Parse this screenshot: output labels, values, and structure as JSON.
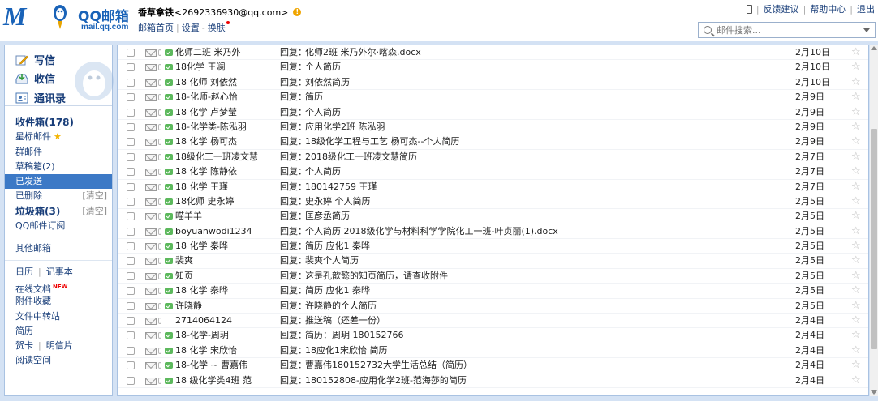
{
  "header": {
    "logo_domain": "mail.qq.com",
    "user_name": "香草拿铁",
    "user_email": "<2692336930@qq.com>",
    "home_link": "邮箱首页",
    "settings_link": "设置",
    "skin_link": "换肤",
    "feedback_link": "反馈建议",
    "help_link": "帮助中心",
    "logout_link": "退出",
    "search_placeholder": "邮件搜索..."
  },
  "sidebar": {
    "write": "写信",
    "inbox": "收信",
    "contacts": "通讯录",
    "folders": {
      "inbox": "收件箱(178)",
      "starred": "星标邮件",
      "group": "群邮件",
      "drafts": "草稿箱(2)",
      "sent": "已发送",
      "deleted": "已删除",
      "deleted_clear": "[清空]",
      "spam": "垃圾箱(3)",
      "spam_clear": "[清空]",
      "subscription": "QQ邮件订阅",
      "other": "其他邮箱",
      "calendar": "日历",
      "notes": "记事本",
      "online_docs": "在线文档",
      "new_badge": "NEW",
      "attachments": "附件收藏",
      "file_transfer": "文件中转站",
      "resume": "简历",
      "cards": "贺卡",
      "postcards": "明信片",
      "reading": "阅读空间"
    }
  },
  "mail_list": [
    {
      "sender": "化师二班 米乃外",
      "prefix": "回复：",
      "subject": "化师2班 米乃外尔·喀森.docx",
      "date": "2月10日",
      "icon": true
    },
    {
      "sender": "18化学 王澜",
      "prefix": "回复：",
      "subject": "个人简历",
      "date": "2月10日",
      "icon": true
    },
    {
      "sender": "18 化师 刘依然",
      "prefix": "回复：",
      "subject": "刘依然简历",
      "date": "2月10日",
      "icon": true
    },
    {
      "sender": "18-化师-赵心怡",
      "prefix": "回复：",
      "subject": "简历",
      "date": "2月9日",
      "icon": true
    },
    {
      "sender": "18 化学 卢梦莹",
      "prefix": "回复：",
      "subject": "个人简历",
      "date": "2月9日",
      "icon": true
    },
    {
      "sender": "18-化学类-陈泓羽",
      "prefix": "回复：",
      "subject": "应用化学2班 陈泓羽",
      "date": "2月9日",
      "icon": true
    },
    {
      "sender": "18 化学 杨可杰",
      "prefix": "回复：",
      "subject": "18级化学工程与工艺 杨可杰--个人简历",
      "date": "2月9日",
      "icon": true
    },
    {
      "sender": "18级化工一班凌文慧",
      "prefix": "回复：",
      "subject": "2018级化工一班凌文慧简历",
      "date": "2月7日",
      "icon": true
    },
    {
      "sender": "18 化学 陈静依",
      "prefix": "回复：",
      "subject": "个人简历",
      "date": "2月7日",
      "icon": true
    },
    {
      "sender": "18 化学 王瑾",
      "prefix": "回复：",
      "subject": "180142759 王瑾",
      "date": "2月7日",
      "icon": true
    },
    {
      "sender": "18化师 史永婷",
      "prefix": "回复：",
      "subject": "史永婷 个人简历",
      "date": "2月5日",
      "icon": true
    },
    {
      "sender": "喵羊羊",
      "prefix": "回复：",
      "subject": "匡彦丞简历",
      "date": "2月5日",
      "icon": true
    },
    {
      "sender": "boyuanwodi1234",
      "prefix": "回复：",
      "subject": "个人简历 2018级化学与材料科学学院化工一班-叶贞丽(1).docx",
      "date": "2月5日",
      "icon": true
    },
    {
      "sender": "18 化学 秦晔",
      "prefix": "回复：",
      "subject": "简历 应化1 秦晔",
      "date": "2月5日",
      "icon": true
    },
    {
      "sender": "裴爽",
      "prefix": "回复：",
      "subject": "裴爽个人简历",
      "date": "2月5日",
      "icon": true
    },
    {
      "sender": "知页",
      "prefix": "回复：",
      "subject": "这是孔歆懿的知页简历，请查收附件",
      "date": "2月5日",
      "icon": true
    },
    {
      "sender": "18 化学 秦晔",
      "prefix": "回复：",
      "subject": "简历 应化1 秦晔",
      "date": "2月5日",
      "icon": true
    },
    {
      "sender": "许晓静",
      "prefix": "回复：",
      "subject": "许晓静的个人简历",
      "date": "2月5日",
      "icon": true
    },
    {
      "sender": "2714064124",
      "prefix": "回复：",
      "subject": "推送稿（还差一份）",
      "date": "2月4日",
      "icon": false
    },
    {
      "sender": "18-化学-周玥",
      "prefix": "回复：",
      "subject": "简历：周玥 180152766",
      "date": "2月4日",
      "icon": true
    },
    {
      "sender": "18 化学 宋欣怡",
      "prefix": "回复：",
      "subject": "18应化1宋欣怡 简历",
      "date": "2月4日",
      "icon": true
    },
    {
      "sender": "18-化学 ~ 曹嘉伟",
      "prefix": "回复：",
      "subject": " 曹嘉伟180152732大学生活总结（简历）",
      "date": "2月4日",
      "icon": true
    },
    {
      "sender": "18 级化学类4班 范",
      "prefix": "回复：",
      "subject": "180152808-应用化学2班-范海莎的简历",
      "date": "2月4日",
      "icon": true
    }
  ]
}
